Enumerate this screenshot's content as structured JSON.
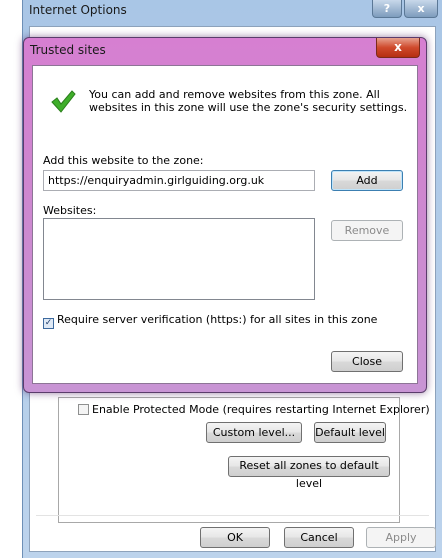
{
  "outer": {
    "title": "Internet Options",
    "help_label": "?",
    "close_label": "x",
    "protected_mode_label": "Enable Protected Mode (requires restarting Internet Explorer)",
    "protected_mode_checked": false,
    "custom_level_label": "Custom level...",
    "default_level_label": "Default level",
    "reset_all_label": "Reset all zones to default level",
    "ok_label": "OK",
    "cancel_label": "Cancel",
    "apply_label": "Apply"
  },
  "dialog": {
    "title": "Trusted sites",
    "close_label": "x",
    "info_text": "You can add and remove websites from this zone. All websites in this zone will use the zone's security settings.",
    "add_label": "Add this website to the zone:",
    "url_value": "https://enquiryadmin.girlguiding.org.uk",
    "add_button_label": "Add",
    "websites_label": "Websites:",
    "websites": [],
    "remove_button_label": "Remove",
    "require_https_label": "Require server verification (https:) for all sites in this zone",
    "require_https_checked": true,
    "close_button_label": "Close"
  }
}
